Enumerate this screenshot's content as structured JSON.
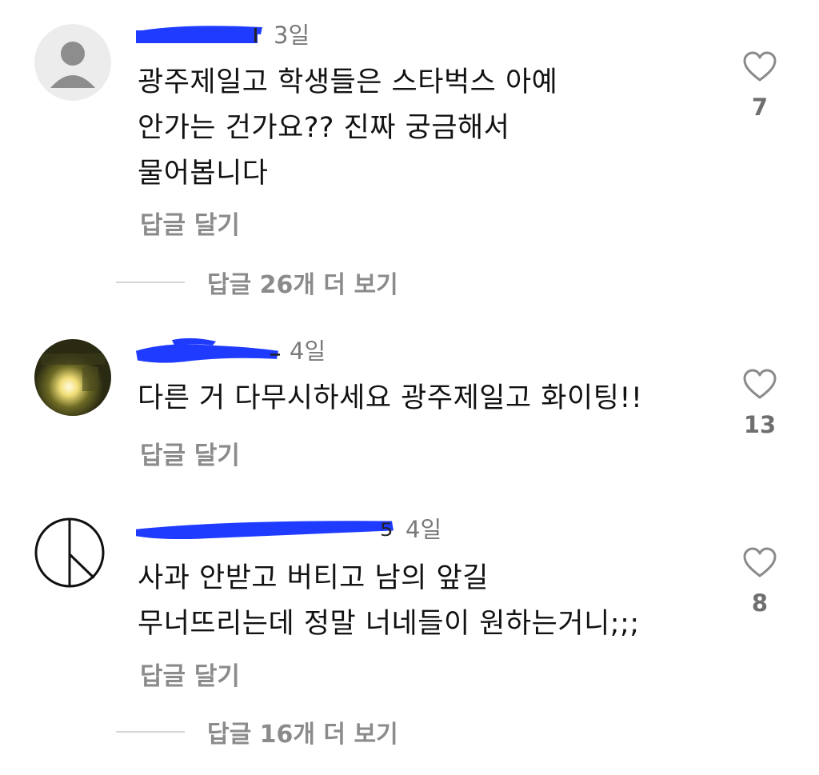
{
  "comments": [
    {
      "avatar": "default-person-avatar",
      "time": "3일",
      "lines": [
        "광주제일고 학생들은 스타벅스 아예",
        "안가는 건가요?? 진짜 궁금해서",
        "물어봅니다"
      ],
      "reply_label": "답글 달기",
      "likes": "7",
      "more_replies": "답글 26개 더 보기"
    },
    {
      "avatar": "photo-avatar",
      "time": "4일",
      "lines": [
        "다른 거 다무시하세요 광주제일고 화이팅!!"
      ],
      "reply_label": "답글 달기",
      "likes": "13"
    },
    {
      "avatar": "peace-symbol-avatar",
      "time": "4일",
      "lines": [
        "사과 안받고 버티고 남의 앞길",
        "무너뜨리는데 정말 너네들이 원하는거니;;;"
      ],
      "reply_label": "답글 달기",
      "likes": "8",
      "more_replies": "답글 16개 더 보기"
    }
  ],
  "colors": {
    "redaction": "#1f3bff",
    "muted": "#8b8b8b",
    "text": "#121212"
  }
}
